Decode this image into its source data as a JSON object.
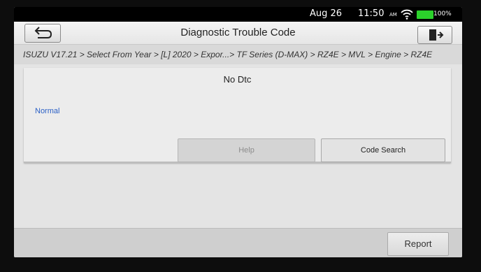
{
  "status_bar": {
    "date": "Aug 26",
    "time": "11:50",
    "ampm": "AM",
    "battery": "100%",
    "battery_level": 1.0,
    "icons": [
      "wifi-icon",
      "battery-icon"
    ]
  },
  "header": {
    "title": "Diagnostic Trouble Code",
    "back_icon": "back-arrow-icon",
    "exit_icon": "exit-door-icon"
  },
  "breadcrumb": "ISUZU V17.21 > Select From Year > [L] 2020 > Expor...> TF Series (D-MAX) > RZ4E > MVL > Engine > RZ4E",
  "result": {
    "message": "No Dtc",
    "status": "Normal",
    "status_color": "#2a5fc5"
  },
  "actions": {
    "help_label": "Help",
    "code_search_label": "Code Search"
  },
  "footer": {
    "report_label": "Report"
  }
}
